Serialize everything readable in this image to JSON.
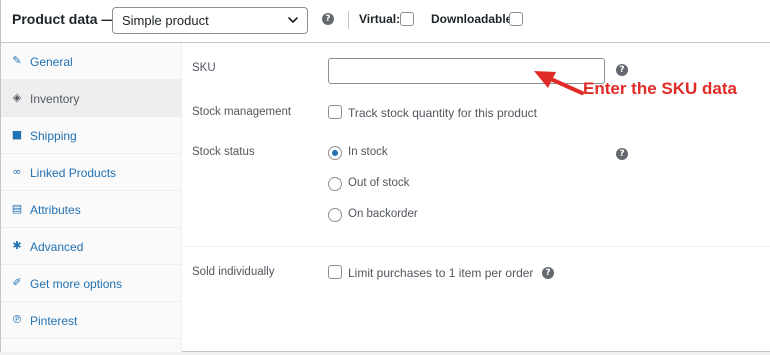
{
  "header": {
    "title": "Product data —",
    "product_type": {
      "selected": "Simple product"
    },
    "virtual_label": "Virtual:",
    "downloadable_label": "Downloadable:"
  },
  "sidebar": {
    "items": [
      {
        "label": "General",
        "icon": "wrench-icon"
      },
      {
        "label": "Inventory",
        "icon": "tag-icon",
        "active": true
      },
      {
        "label": "Shipping",
        "icon": "truck-icon"
      },
      {
        "label": "Linked Products",
        "icon": "link-icon"
      },
      {
        "label": "Attributes",
        "icon": "list-icon"
      },
      {
        "label": "Advanced",
        "icon": "gear-icon"
      },
      {
        "label": "Get more options",
        "icon": "plugin-icon"
      },
      {
        "label": "Pinterest",
        "icon": "pinterest-icon"
      }
    ]
  },
  "inventory": {
    "sku": {
      "label": "SKU",
      "value": ""
    },
    "stock_management": {
      "label": "Stock management",
      "checkbox_label": "Track stock quantity for this product"
    },
    "stock_status": {
      "label": "Stock status",
      "options": [
        "In stock",
        "Out of stock",
        "On backorder"
      ],
      "selected": "In stock"
    },
    "sold_individually": {
      "label": "Sold individually",
      "checkbox_label": "Limit purchases to 1 item per order"
    }
  },
  "annotation": {
    "text": "Enter the SKU data",
    "color": "#e02b27"
  },
  "colors": {
    "link": "#2271b1",
    "accent_red": "#e02b27"
  }
}
